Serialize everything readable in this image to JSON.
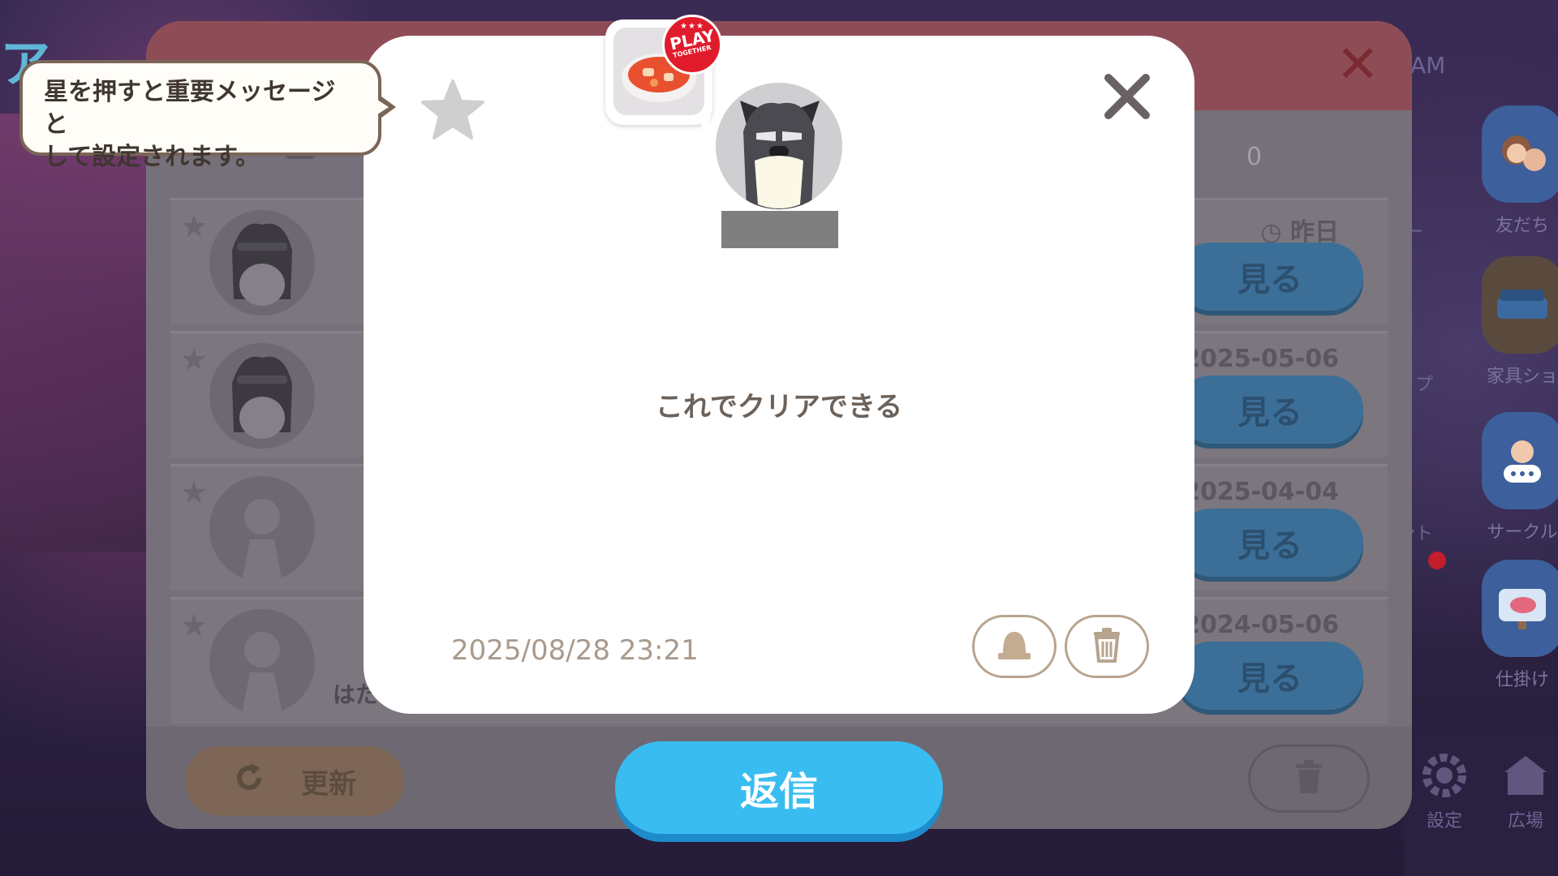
{
  "background": {
    "title_partial": "ア",
    "am_label": "AM",
    "side_menu": [
      {
        "label": "友だち",
        "icon": "friends-icon"
      },
      {
        "label": "家具ショ",
        "icon": "furniture-shop-icon"
      },
      {
        "label": "サークル",
        "icon": "circle-chat-icon"
      },
      {
        "label": "仕掛け",
        "icon": "gimmick-fish-icon"
      }
    ],
    "side_partials": [
      "ィー",
      "ョップ",
      "ベント"
    ],
    "dock": [
      {
        "label": "設定",
        "icon": "settings-gear-icon"
      },
      {
        "label": "広場",
        "icon": "plaza-building-icon"
      }
    ]
  },
  "mailbox": {
    "tab_count": "0",
    "rows": [
      {
        "date": "昨日",
        "date_icon": "clock-icon",
        "button": "見る",
        "avatar": "dog-avatar",
        "name": ""
      },
      {
        "date": "2025-05-06",
        "button": "見る",
        "avatar": "dog-avatar",
        "name": ""
      },
      {
        "date": "2025-04-04",
        "button": "見る",
        "avatar": "default-avatar",
        "name": ""
      },
      {
        "date": "2024-05-06",
        "button": "見る",
        "avatar": "default-avatar",
        "name": "はた"
      }
    ],
    "refresh_label": "更新"
  },
  "tooltip": {
    "text": "星を押すと重要メッセージと\nして設定されます。"
  },
  "dialog": {
    "message": "これでクリアできる",
    "date": "2025/08/28 23:21",
    "sticker_badge": {
      "top": "★★★",
      "main": "PLAY",
      "sub": "TOGETHER"
    }
  },
  "reply_label": "返信",
  "colors": {
    "reply_button": "#39bdf1",
    "view_button_dim": "#3b6f98",
    "dialog_bg": "#ffffff",
    "header_red_dim": "#8e4d56"
  }
}
